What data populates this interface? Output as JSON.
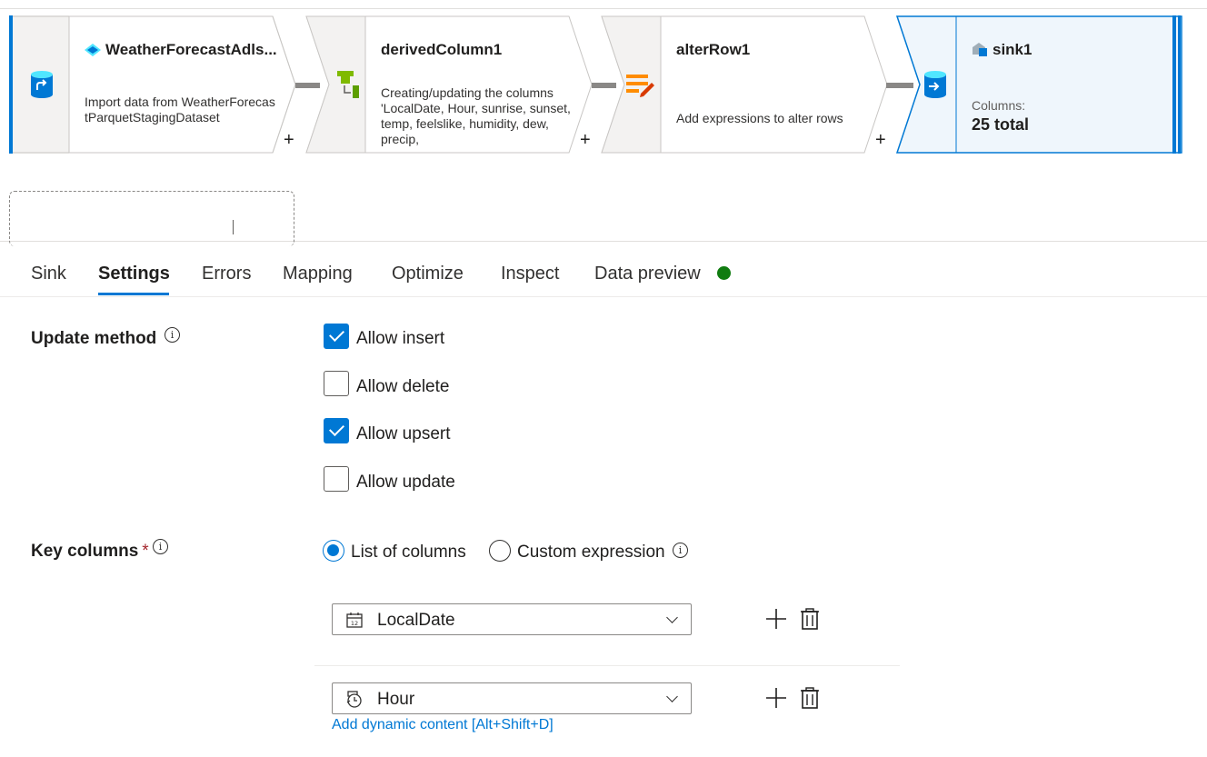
{
  "flow": {
    "nodes": [
      {
        "title": "WeatherForecastAdls...",
        "description": "Import data from WeatherForecastParquetStagingDataset"
      },
      {
        "title": "derivedColumn1",
        "description": "Creating/updating the columns 'LocalDate, Hour, sunrise, sunset, temp, feelslike, humidity, dew, precip,"
      },
      {
        "title": "alterRow1",
        "description": "Add expressions to alter rows"
      },
      {
        "title": "sink1",
        "columns_label": "Columns:",
        "columns_value": "25 total"
      }
    ],
    "add_symbol": "+"
  },
  "tabs": [
    {
      "label": "Sink"
    },
    {
      "label": "Settings",
      "active": true
    },
    {
      "label": "Errors"
    },
    {
      "label": "Mapping"
    },
    {
      "label": "Optimize"
    },
    {
      "label": "Inspect"
    },
    {
      "label": "Data preview",
      "status_color": "#107c10"
    }
  ],
  "settings": {
    "update_method": {
      "label": "Update method",
      "info": "i",
      "options": [
        {
          "label": "Allow insert",
          "checked": true
        },
        {
          "label": "Allow delete",
          "checked": false
        },
        {
          "label": "Allow upsert",
          "checked": true
        },
        {
          "label": "Allow update",
          "checked": false
        }
      ]
    },
    "key_columns": {
      "label": "Key columns",
      "required_marker": "*",
      "info": "i",
      "mode_options": [
        {
          "label": "List of columns",
          "selected": true
        },
        {
          "label": "Custom expression",
          "selected": false
        }
      ],
      "columns": [
        {
          "value": "LocalDate",
          "icon": "calendar-icon"
        },
        {
          "value": "Hour",
          "icon": "clock-icon"
        }
      ],
      "dynamic_content_link": "Add dynamic content [Alt+Shift+D]"
    }
  },
  "colors": {
    "accent": "#0078d4",
    "status_ok": "#107c10",
    "node_fill": "#f3f2f1",
    "sink_fill": "#eff6fc"
  }
}
